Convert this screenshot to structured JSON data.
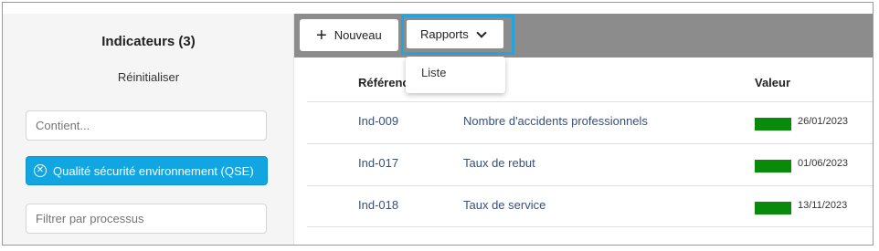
{
  "sidebar": {
    "title": "Indicateurs (3)",
    "reset_label": "Réinitialiser",
    "contains_placeholder": "Contient...",
    "active_filter": "Qualité sécurité environnement (QSE)",
    "process_placeholder": "Filtrer par processus"
  },
  "toolbar": {
    "new_label": "Nouveau",
    "reports_label": "Rapports",
    "reports_menu": [
      "Liste"
    ]
  },
  "table": {
    "columns": [
      "Référence",
      "Valeur"
    ],
    "rows": [
      {
        "ref": "Ind-009",
        "name": "Nombre d'accidents professionnels",
        "date": "26/01/2023",
        "status_color": "#0a8a0a"
      },
      {
        "ref": "Ind-017",
        "name": "Taux de rebut",
        "date": "01/06/2023",
        "status_color": "#0a8a0a"
      },
      {
        "ref": "Ind-018",
        "name": "Taux de service",
        "date": "13/11/2023",
        "status_color": "#0a8a0a"
      }
    ]
  },
  "colors": {
    "accent": "#11a6e2",
    "toolbar": "#8c8c8c",
    "status_ok": "#0a8a0a",
    "link": "#3a4f78"
  }
}
